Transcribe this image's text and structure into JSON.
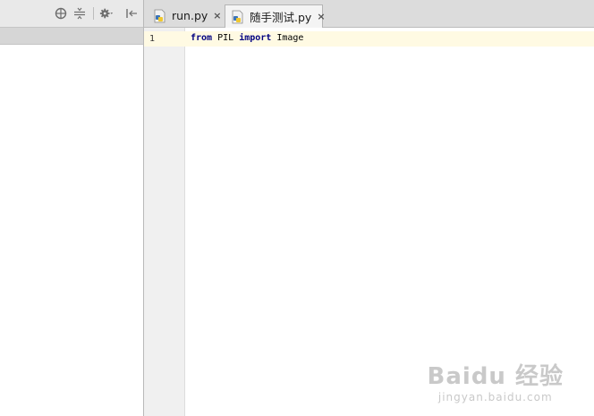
{
  "left_panel": {
    "toolbar_icons": [
      "locate-icon",
      "collapse-all-icon",
      "gear-icon",
      "hide-panel-icon"
    ]
  },
  "tabs": [
    {
      "label": "run.py",
      "active": false,
      "icon": "python-file-icon"
    },
    {
      "label": "随手测试.py",
      "active": true,
      "icon": "python-file-icon"
    }
  ],
  "tab_close_glyph": "×",
  "editor": {
    "line_numbers": [
      "1"
    ],
    "code": {
      "kw_from": "from",
      "module": " PIL ",
      "kw_import": "import",
      "name": " Image"
    }
  },
  "watermark": {
    "main": "Baidu 经验",
    "sub": "jingyan.baidu.com"
  },
  "colors": {
    "keyword": "#000080",
    "current_line": "#fffae3",
    "gutter": "#f0f0f0",
    "tab_bar": "#dcdcdc"
  }
}
